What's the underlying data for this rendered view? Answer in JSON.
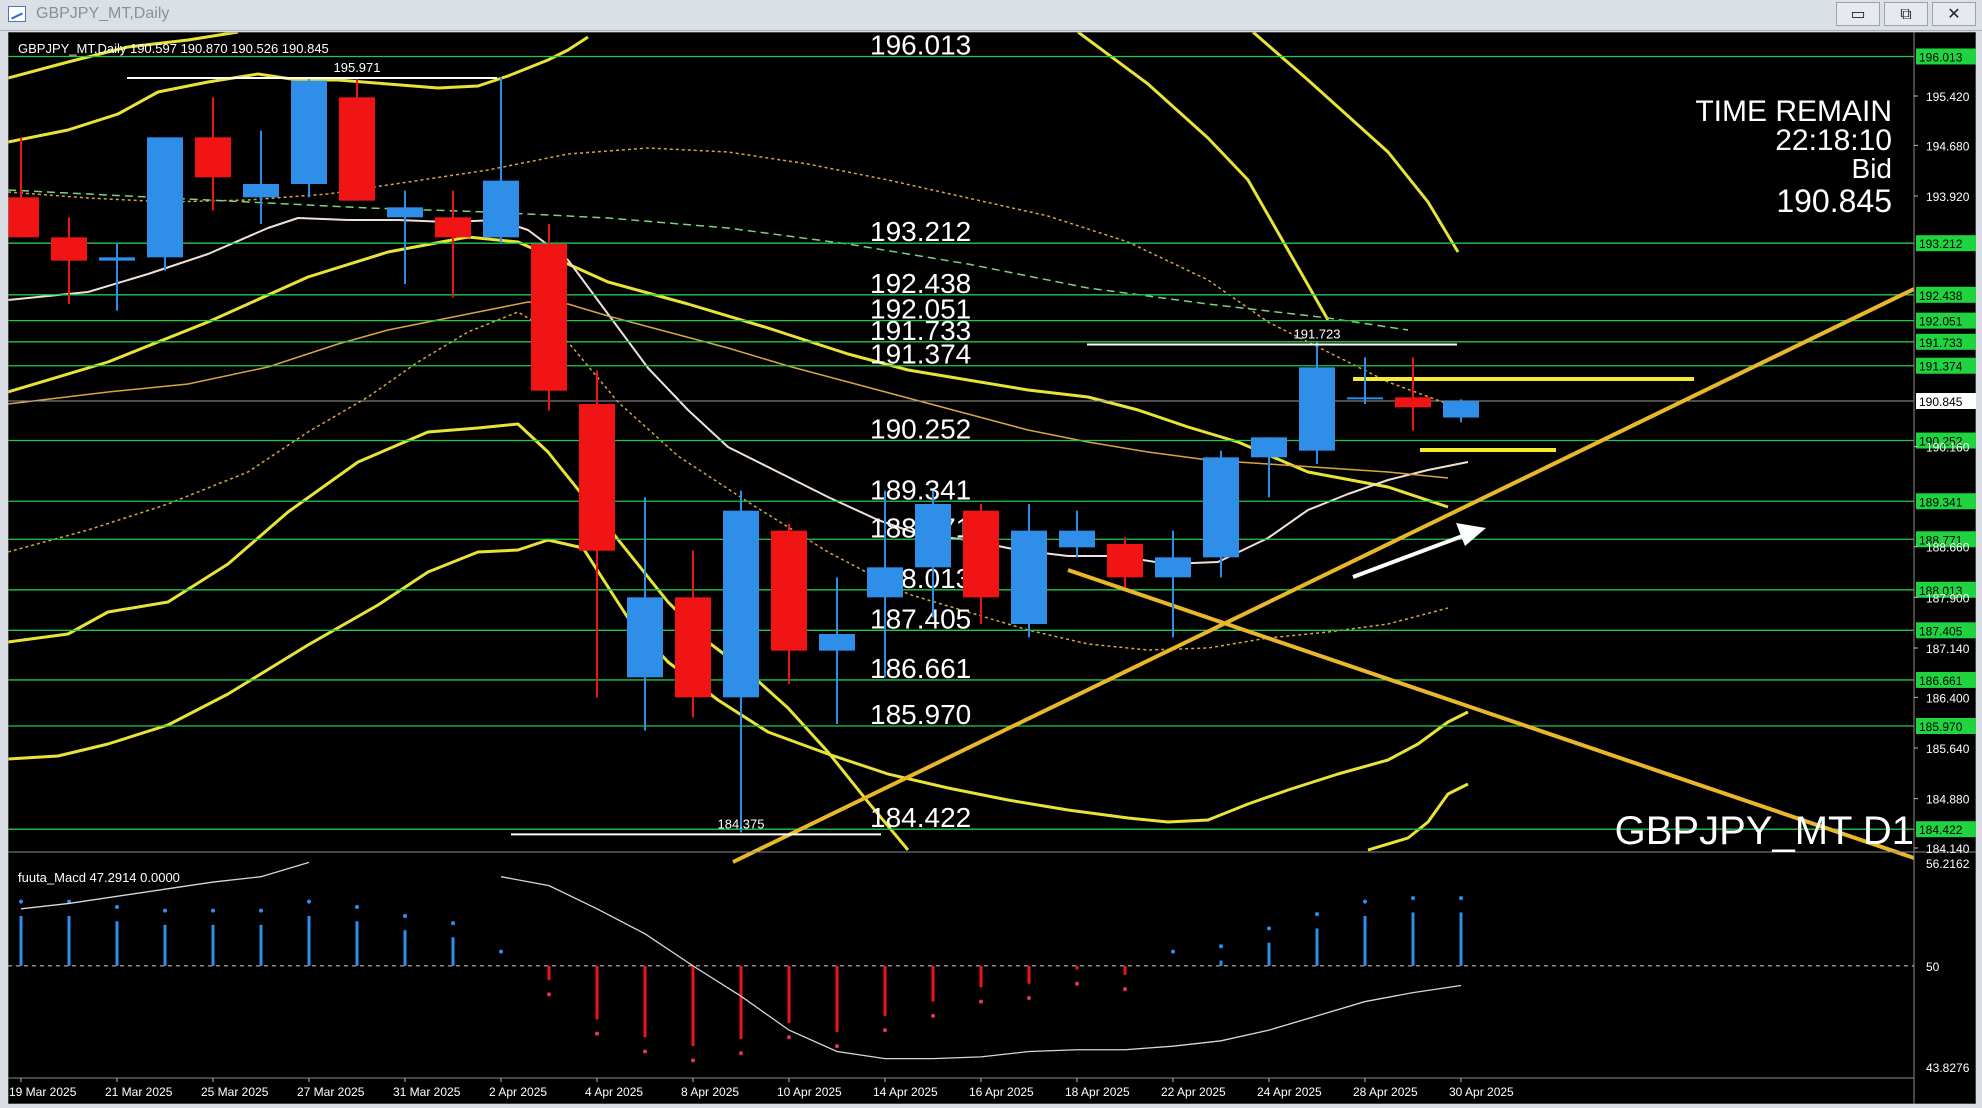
{
  "window": {
    "title": "GBPJPY_MT,Daily",
    "min_glyph": "▭",
    "max_glyph": "⧉",
    "close_glyph": "✕"
  },
  "main_chart": {
    "header": "GBPJPY_MT,Daily  190.597 190.870 190.526 190.845",
    "symbol_label": "GBPJPY_MT D1",
    "time_remain_label": "TIME REMAIN",
    "time_remain": "22:18:10",
    "bid_label": "Bid",
    "bid": "190.845",
    "annotations": [
      {
        "text": "195.971",
        "price": 195.971,
        "index": 7
      },
      {
        "text": "191.723",
        "price": 191.723,
        "index": 27
      },
      {
        "text": "184.375",
        "price": 184.375,
        "index": 15
      }
    ]
  },
  "levels": [
    {
      "label": "196.013",
      "price": 196.013
    },
    {
      "label": "193.212",
      "price": 193.212
    },
    {
      "label": "192.438",
      "price": 192.438
    },
    {
      "label": "192.051",
      "price": 192.051
    },
    {
      "label": "191.733",
      "price": 191.733
    },
    {
      "label": "191.374",
      "price": 191.374
    },
    {
      "label": "190.252",
      "price": 190.252
    },
    {
      "label": "189.341",
      "price": 189.341
    },
    {
      "label": "188.771",
      "price": 188.771
    },
    {
      "label": "188.013",
      "price": 188.013
    },
    {
      "label": "187.405",
      "price": 187.405
    },
    {
      "label": "186.661",
      "price": 186.661
    },
    {
      "label": "185.970",
      "price": 185.97
    },
    {
      "label": "184.422",
      "price": 184.422
    }
  ],
  "price_axis_ticks": [
    {
      "label": "195.420",
      "price": 195.42
    },
    {
      "label": "194.680",
      "price": 194.68
    },
    {
      "label": "193.920",
      "price": 193.92
    },
    {
      "label": "190.160",
      "price": 190.16
    },
    {
      "label": "188.660",
      "price": 188.66
    },
    {
      "label": "187.900",
      "price": 187.9
    },
    {
      "label": "187.140",
      "price": 187.14
    },
    {
      "label": "186.400",
      "price": 186.4
    },
    {
      "label": "185.640",
      "price": 185.64
    },
    {
      "label": "184.880",
      "price": 184.88
    },
    {
      "label": "184.140",
      "price": 184.14
    }
  ],
  "chart_data": {
    "type": "candlestick",
    "symbol": "GBPJPY_MT",
    "timeframe": "Daily",
    "current_price": 190.845,
    "ylim": [
      184.1,
      196.4
    ],
    "candles": [
      {
        "o": 193.9,
        "h": 194.8,
        "l": 193.3,
        "c": 193.3
      },
      {
        "o": 193.3,
        "h": 193.6,
        "l": 192.3,
        "c": 192.95
      },
      {
        "o": 192.95,
        "h": 193.2,
        "l": 192.2,
        "c": 193.0
      },
      {
        "o": 193.0,
        "h": 194.8,
        "l": 192.8,
        "c": 194.8
      },
      {
        "o": 194.8,
        "h": 195.4,
        "l": 193.7,
        "c": 194.2
      },
      {
        "o": 193.9,
        "h": 194.9,
        "l": 193.5,
        "c": 194.1
      },
      {
        "o": 194.1,
        "h": 195.7,
        "l": 193.9,
        "c": 195.65
      },
      {
        "o": 195.4,
        "h": 195.7,
        "l": 193.85,
        "c": 193.85
      },
      {
        "o": 193.6,
        "h": 194.0,
        "l": 192.6,
        "c": 193.75
      },
      {
        "o": 193.6,
        "h": 194.0,
        "l": 192.4,
        "c": 193.3
      },
      {
        "o": 193.3,
        "h": 195.7,
        "l": 193.2,
        "c": 194.15
      },
      {
        "o": 193.2,
        "h": 193.5,
        "l": 190.7,
        "c": 191.0
      },
      {
        "o": 190.8,
        "h": 191.3,
        "l": 186.4,
        "c": 188.6
      },
      {
        "o": 186.7,
        "h": 189.4,
        "l": 185.9,
        "c": 187.9
      },
      {
        "o": 187.9,
        "h": 188.6,
        "l": 186.1,
        "c": 186.4
      },
      {
        "o": 186.4,
        "h": 189.5,
        "l": 184.375,
        "c": 189.2
      },
      {
        "o": 188.9,
        "h": 189.0,
        "l": 186.6,
        "c": 187.1
      },
      {
        "o": 187.1,
        "h": 188.2,
        "l": 186.0,
        "c": 187.35
      },
      {
        "o": 187.9,
        "h": 189.5,
        "l": 186.7,
        "c": 188.35
      },
      {
        "o": 188.35,
        "h": 189.5,
        "l": 187.6,
        "c": 189.3
      },
      {
        "o": 189.2,
        "h": 189.3,
        "l": 187.5,
        "c": 187.9
      },
      {
        "o": 187.5,
        "h": 189.3,
        "l": 187.3,
        "c": 188.9
      },
      {
        "o": 188.65,
        "h": 189.2,
        "l": 188.5,
        "c": 188.9
      },
      {
        "o": 188.7,
        "h": 188.8,
        "l": 188.05,
        "c": 188.2
      },
      {
        "o": 188.2,
        "h": 188.9,
        "l": 187.3,
        "c": 188.5
      },
      {
        "o": 188.5,
        "h": 190.1,
        "l": 188.2,
        "c": 190.0
      },
      {
        "o": 190.0,
        "h": 190.3,
        "l": 189.4,
        "c": 190.3
      },
      {
        "o": 190.1,
        "h": 191.723,
        "l": 189.9,
        "c": 191.35
      },
      {
        "o": 190.9,
        "h": 191.5,
        "l": 190.8,
        "c": 190.9
      },
      {
        "o": 190.9,
        "h": 191.5,
        "l": 190.4,
        "c": 190.75
      },
      {
        "o": 190.597,
        "h": 190.87,
        "l": 190.526,
        "c": 190.845
      }
    ],
    "x_labels": [
      {
        "label": "19 Mar 2025",
        "index": 0
      },
      {
        "label": "21 Mar 2025",
        "index": 2
      },
      {
        "label": "25 Mar 2025",
        "index": 4
      },
      {
        "label": "27 Mar 2025",
        "index": 6
      },
      {
        "label": "31 Mar 2025",
        "index": 8
      },
      {
        "label": "2 Apr 2025",
        "index": 10
      },
      {
        "label": "4 Apr 2025",
        "index": 12
      },
      {
        "label": "8 Apr 2025",
        "index": 14
      },
      {
        "label": "10 Apr 2025",
        "index": 16
      },
      {
        "label": "14 Apr 2025",
        "index": 18
      },
      {
        "label": "16 Apr 2025",
        "index": 20
      },
      {
        "label": "18 Apr 2025",
        "index": 22
      },
      {
        "label": "22 Apr 2025",
        "index": 24
      },
      {
        "label": "24 Apr 2025",
        "index": 26
      },
      {
        "label": "28 Apr 2025",
        "index": 28
      },
      {
        "label": "30 Apr 2025",
        "index": 30
      }
    ],
    "indicator": {
      "header": "fuuta_Macd 47.2914  0.0000",
      "ylim": [
        43.8276,
        56.2162
      ],
      "axis_labels": [
        {
          "label": "56.2162",
          "value": 56.2162
        },
        {
          "label": "50",
          "value": 50
        },
        {
          "label": "43.8276",
          "value": 43.8276
        }
      ],
      "bars": [
        52.8,
        52.8,
        52.5,
        52.3,
        52.3,
        52.3,
        52.8,
        52.5,
        52.0,
        51.6,
        50,
        49.2,
        47.0,
        46.0,
        45.5,
        45.9,
        46.8,
        46.3,
        47.2,
        48.0,
        48.8,
        49.0,
        49.8,
        49.5,
        50,
        50.3,
        51.3,
        52.1,
        52.8,
        53.0,
        53.0
      ],
      "signal": [
        53.2,
        53.5,
        53.9,
        54.3,
        54.7,
        55.0,
        55.8,
        null,
        null,
        null,
        55.0,
        54.5,
        53.2,
        51.8,
        50.0,
        48.3,
        46.4,
        45.2,
        44.8,
        44.8,
        44.9,
        45.2,
        45.3,
        45.3,
        45.5,
        45.8,
        46.4,
        47.2,
        48.0,
        48.5,
        48.9
      ]
    }
  }
}
